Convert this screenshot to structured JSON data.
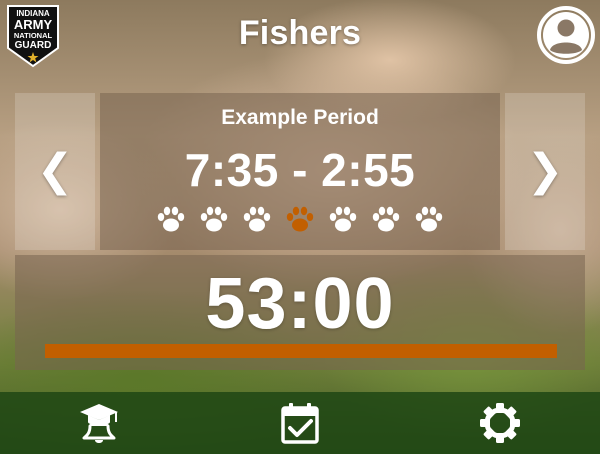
{
  "header": {
    "title": "Fishers",
    "logo": {
      "line1": "INDIANA",
      "line2": "ARMY",
      "line3": "NATIONAL",
      "line4": "GUARD"
    }
  },
  "period": {
    "name": "Example Period",
    "time_range": "7:35 - 2:55",
    "prev_arrow": "❮",
    "next_arrow": "❯",
    "paw_count": 7,
    "active_paw_index": 3
  },
  "timer": {
    "countdown": "53:00",
    "progress_fraction": 1.0
  },
  "bottom_nav": {
    "items": [
      {
        "icon": "graduation-bell-icon"
      },
      {
        "icon": "calendar-check-icon"
      },
      {
        "icon": "gear-icon"
      }
    ]
  },
  "colors": {
    "accent": "#c25f00",
    "paw_default": "#ffffff",
    "paw_active": "#c25f00",
    "nav_bar": "#1e4614"
  }
}
